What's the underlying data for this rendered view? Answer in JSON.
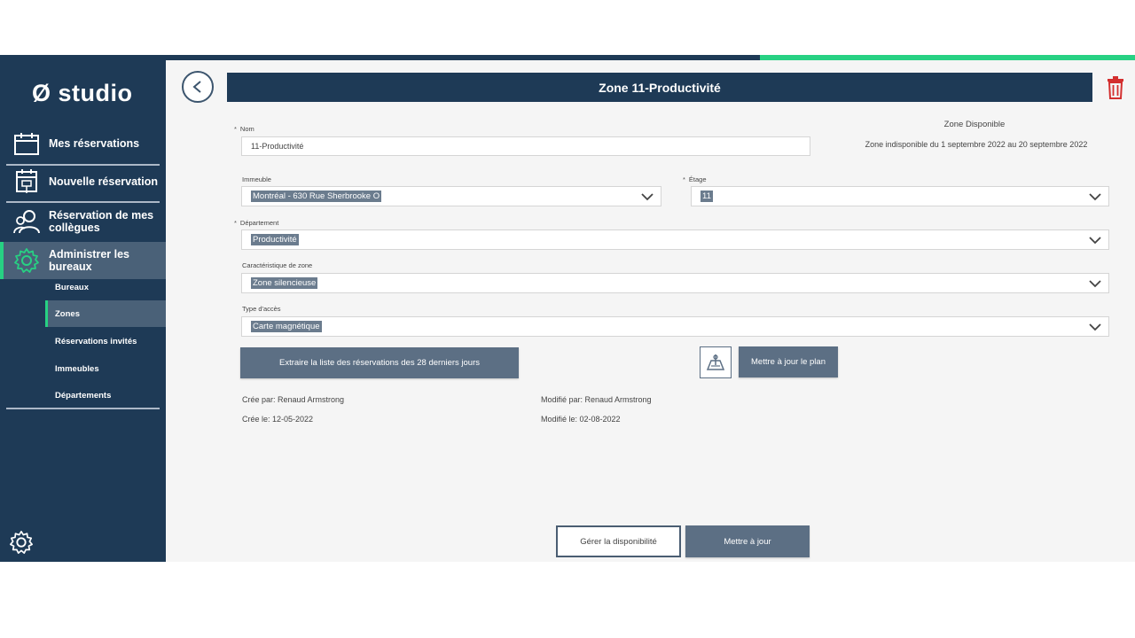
{
  "colors": {
    "navy": "#1e3a56",
    "accent": "#27d183",
    "button": "#5c6f84",
    "danger": "#d32f2f"
  },
  "sidebar": {
    "logo": "Ø studio",
    "items": [
      {
        "label": "Mes réservations",
        "icon": "calendar-icon"
      },
      {
        "label": "Nouvelle réservation",
        "icon": "calendar-desk-icon"
      },
      {
        "label": "Réservation de mes collègues",
        "icon": "users-icon"
      },
      {
        "label": "Administrer les bureaux",
        "icon": "gear-icon",
        "active": true
      }
    ],
    "subitems": [
      {
        "label": "Bureaux"
      },
      {
        "label": "Zones",
        "active": true
      },
      {
        "label": "Réservations invités"
      },
      {
        "label": "Immeubles"
      },
      {
        "label": "Départements"
      }
    ],
    "bottom_icon": "settings-gear-icon"
  },
  "header": {
    "title": "Zone 11-Productivité",
    "back_icon": "chevron-left-icon",
    "delete_icon": "trash-icon"
  },
  "form": {
    "nom": {
      "label": "Nom",
      "value": "11-Productivité",
      "required": "*"
    },
    "immeuble": {
      "label": "Immeuble",
      "value": "Montréal - 630 Rue Sherbrooke O"
    },
    "etage": {
      "label": "Étage",
      "value": "11",
      "required": "*"
    },
    "departement": {
      "label": "Département",
      "value": "Productivité",
      "required": "*"
    },
    "caracteristique": {
      "label": "Caractéristique de zone",
      "value": "Zone silencieuse"
    },
    "acces": {
      "label": "Type d'accès",
      "value": "Carte magnétique"
    }
  },
  "availability": {
    "title": "Zone Disponible",
    "text": "Zone indisponible du 1 septembre 2022 au 20 septembre 2022"
  },
  "actions": {
    "export_label": "Extraire la liste des réservations des 28 derniers jours",
    "update_plan_label": "Mettre à jour le plan",
    "plan_icon": "floor-plan-icon",
    "manage_label": "Gérer la disponibilité",
    "update_label": "Mettre à jour"
  },
  "meta": {
    "created_by": "Crée par: Renaud Armstrong",
    "created_on": "Crée le: 12-05-2022",
    "modified_by": "Modifié par: Renaud Armstrong",
    "modified_on": "Modifié le: 02-08-2022"
  }
}
